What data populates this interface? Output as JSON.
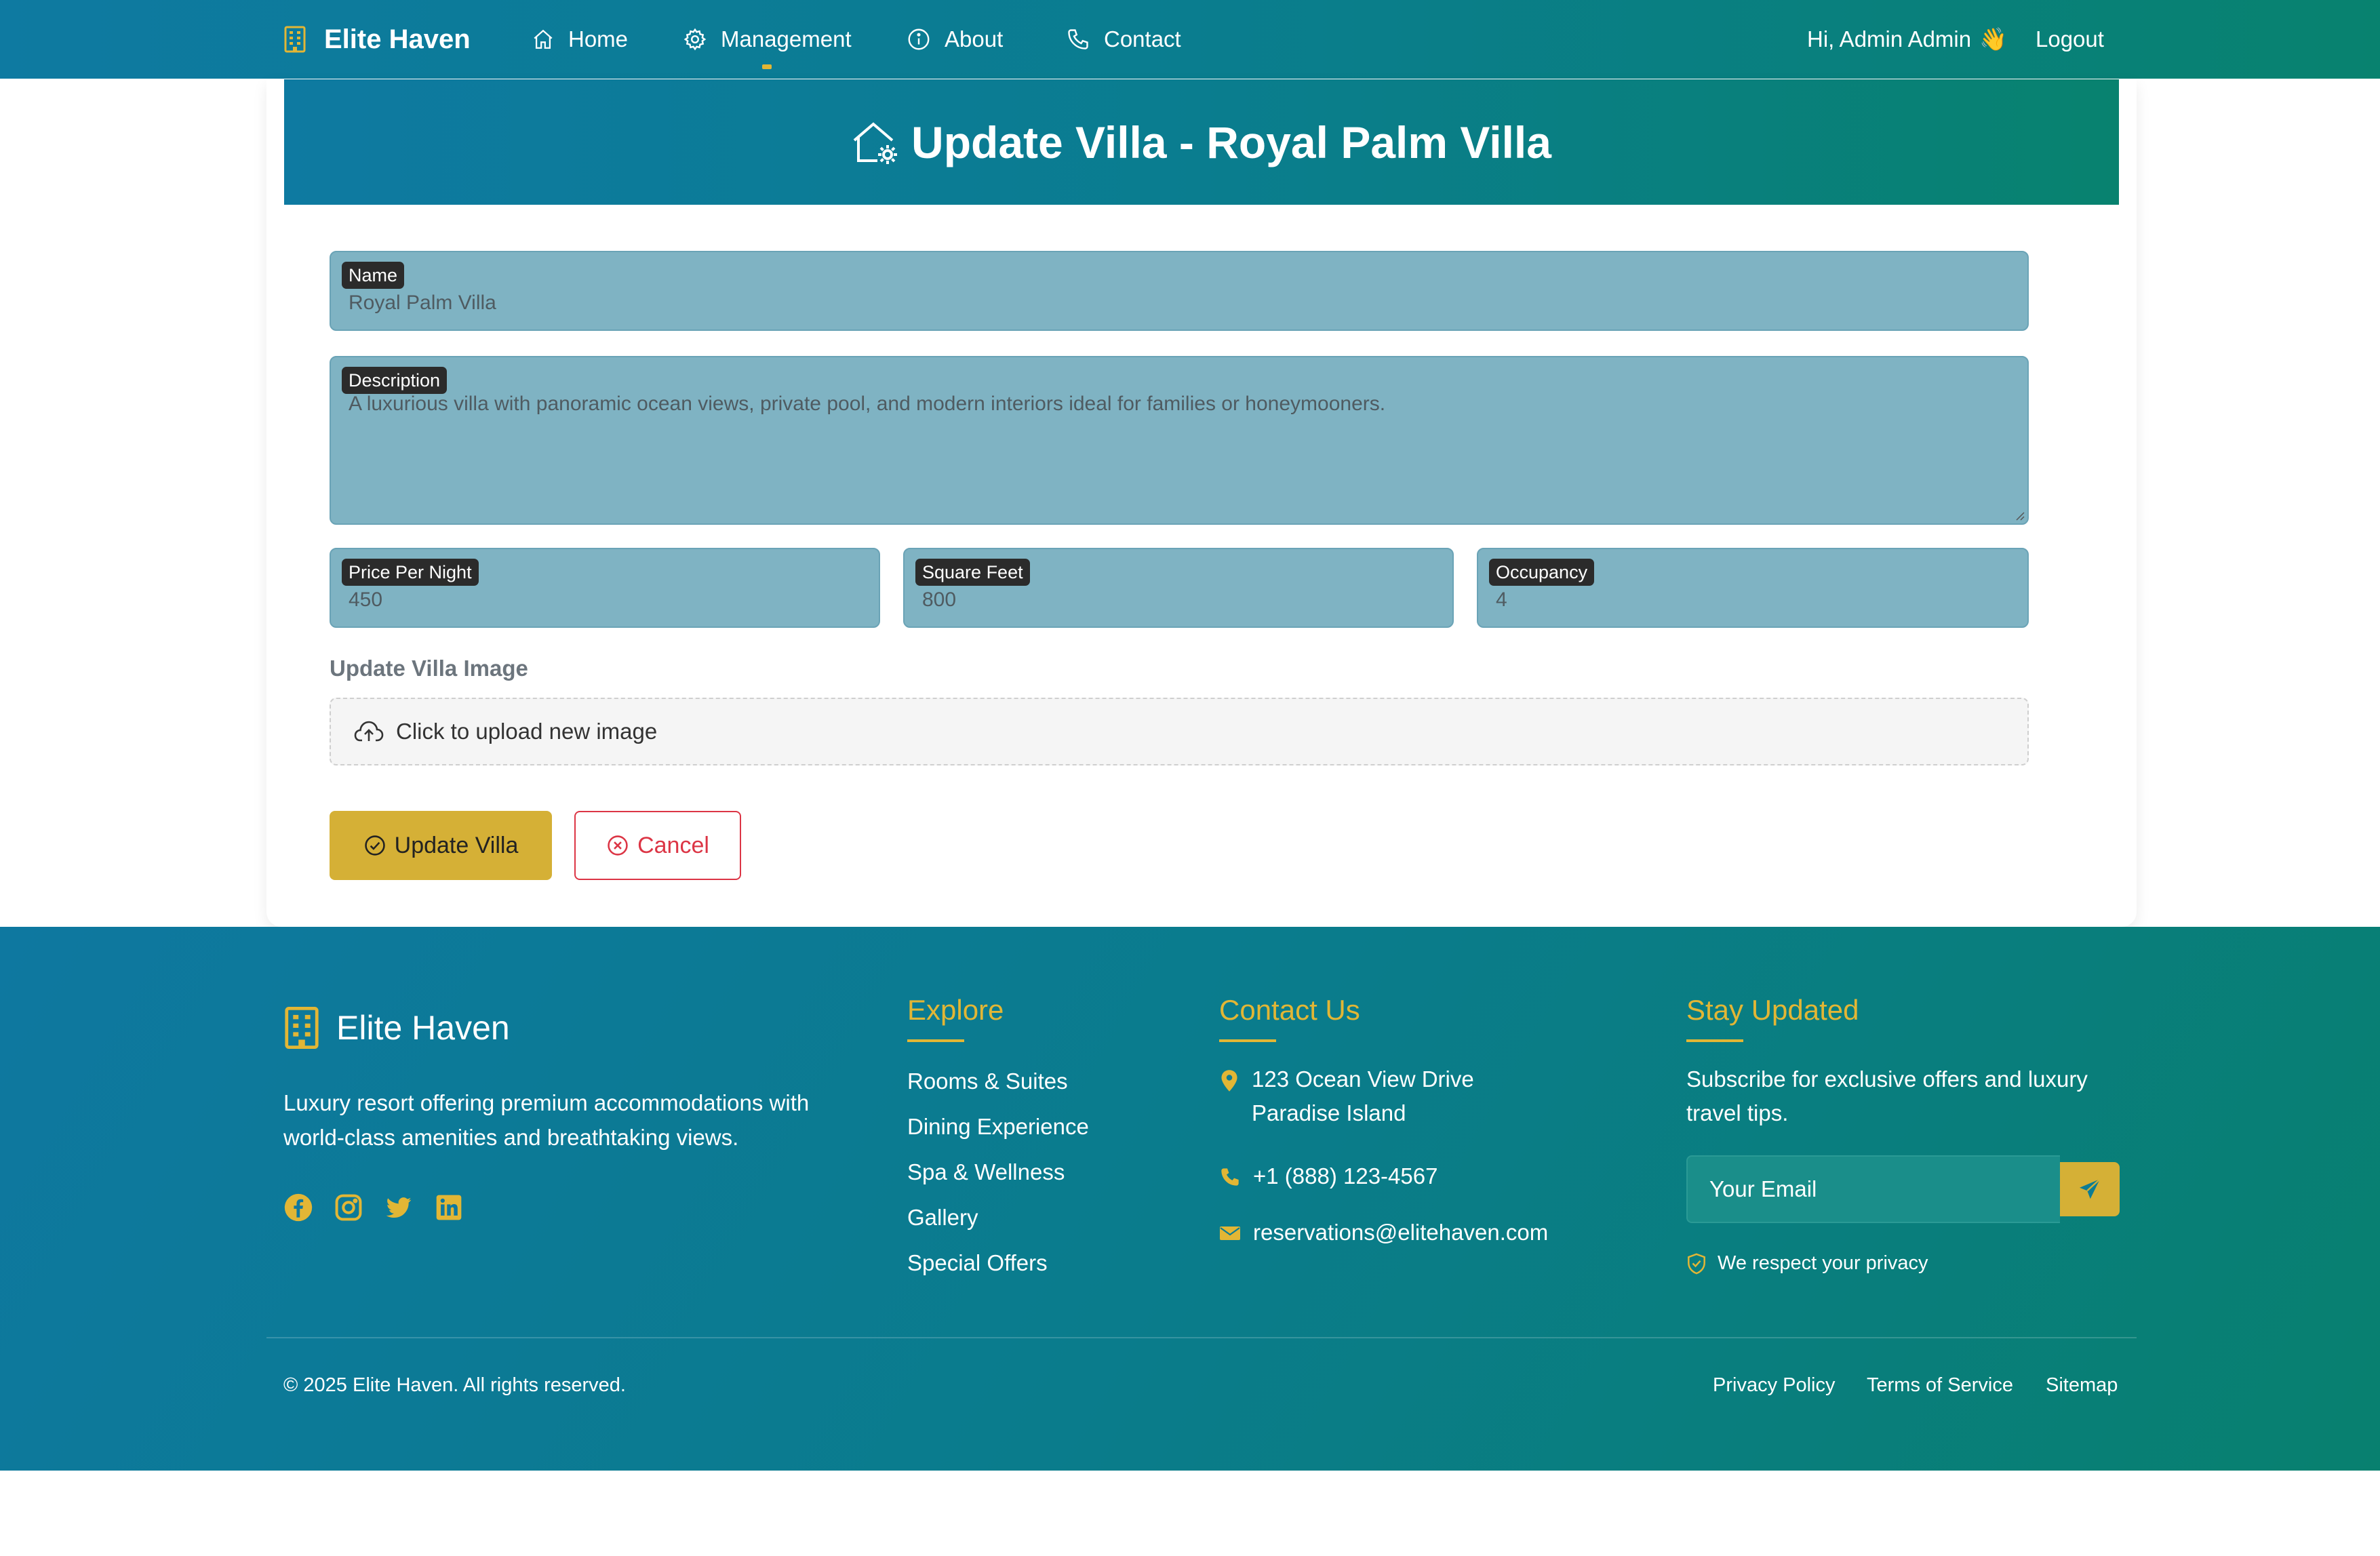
{
  "navbar": {
    "brand": "Elite Haven",
    "items": [
      {
        "label": "Home",
        "icon": "home-icon"
      },
      {
        "label": "Management",
        "icon": "gear-icon"
      },
      {
        "label": "About",
        "icon": "info-icon"
      },
      {
        "label": "Contact",
        "icon": "phone-icon"
      }
    ],
    "greeting": "Hi, Admin Admin",
    "greeting_emoji": "👋",
    "logout": "Logout"
  },
  "form": {
    "title": "Update Villa - Royal Palm Villa",
    "name": {
      "label": "Name",
      "value": "Royal Palm Villa"
    },
    "description": {
      "label": "Description",
      "value": "A luxurious villa with panoramic ocean views, private pool, and modern interiors ideal for families or honeymooners."
    },
    "price": {
      "label": "Price Per Night",
      "value": "450"
    },
    "sqft": {
      "label": "Square Feet",
      "value": "800"
    },
    "occupancy": {
      "label": "Occupancy",
      "value": "4"
    },
    "image_label": "Update Villa Image",
    "upload_text": "Click to upload new image",
    "submit": "Update Villa",
    "cancel": "Cancel"
  },
  "footer": {
    "brand": "Elite Haven",
    "description": "Luxury resort offering premium accommodations with world-class amenities and breathtaking views.",
    "social": [
      "facebook-icon",
      "instagram-icon",
      "twitter-icon",
      "linkedin-icon"
    ],
    "explore": {
      "heading": "Explore",
      "links": [
        "Rooms & Suites",
        "Dining Experience",
        "Spa & Wellness",
        "Gallery",
        "Special Offers"
      ]
    },
    "contact": {
      "heading": "Contact Us",
      "address_line1": "123 Ocean View Drive",
      "address_line2": "Paradise Island",
      "phone": "+1 (888) 123-4567",
      "email": "reservations@elitehaven.com"
    },
    "newsletter": {
      "heading": "Stay Updated",
      "text": "Subscribe for exclusive offers and luxury travel tips.",
      "placeholder": "Your Email",
      "privacy": "We respect your privacy"
    },
    "copyright": "© 2025 Elite Haven. All rights reserved.",
    "bottom_links": [
      "Privacy Policy",
      "Terms of Service",
      "Sitemap"
    ]
  },
  "colors": {
    "accent": "#d5b036",
    "gradient_start": "#0e7aa1",
    "gradient_end": "#08826f",
    "danger": "#dc3545",
    "field_bg": "#7fb3c3"
  }
}
